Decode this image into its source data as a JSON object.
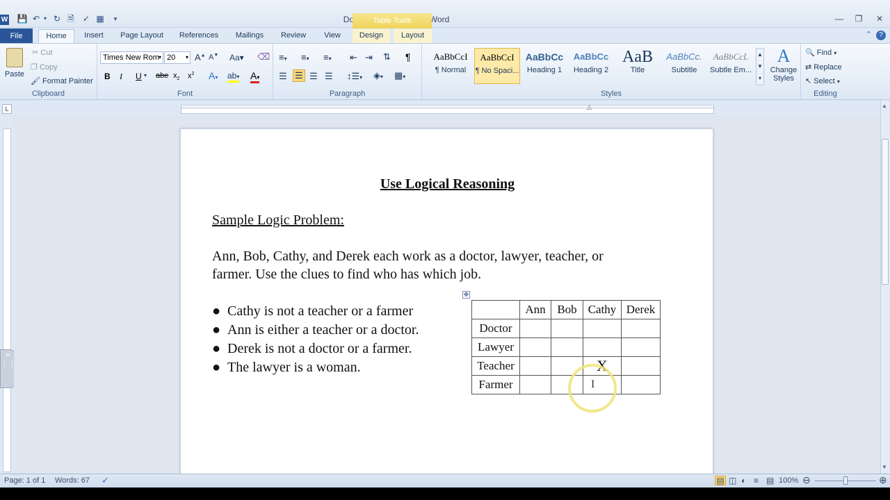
{
  "window": {
    "title": "Document1 - Microsoft Word",
    "context_tab": "Table Tools"
  },
  "tabs": {
    "file": "File",
    "home": "Home",
    "insert": "Insert",
    "page_layout": "Page Layout",
    "references": "References",
    "mailings": "Mailings",
    "review": "Review",
    "view": "View",
    "design": "Design",
    "layout": "Layout"
  },
  "clipboard": {
    "paste": "Paste",
    "cut": "Cut",
    "copy": "Copy",
    "format_painter": "Format Painter",
    "label": "Clipboard"
  },
  "font": {
    "name": "Times New Rom",
    "size": "20",
    "label": "Font"
  },
  "paragraph": {
    "label": "Paragraph"
  },
  "styles": {
    "label": "Styles",
    "items": [
      {
        "sample": "AaBbCcI",
        "name": "¶ Normal"
      },
      {
        "sample": "AaBbCcI",
        "name": "¶ No Spaci..."
      },
      {
        "sample": "AaBbCc",
        "name": "Heading 1"
      },
      {
        "sample": "AaBbCc",
        "name": "Heading 2"
      },
      {
        "sample": "AaB",
        "name": "Title"
      },
      {
        "sample": "AaBbCc.",
        "name": "Subtitle"
      },
      {
        "sample": "AaBbCcL",
        "name": "Subtle Em..."
      }
    ],
    "change_styles": "Change Styles"
  },
  "editing": {
    "find": "Find",
    "replace": "Replace",
    "select": "Select",
    "label": "Editing"
  },
  "document": {
    "title": "Use Logical Reasoning",
    "subtitle": "Sample Logic Problem:",
    "para_line1": "Ann, Bob, Cathy, and Derek each work as a doctor, lawyer, teacher, or",
    "para_line2": "farmer.  Use the clues to find who has which job.",
    "clues": [
      "Cathy is not a teacher or a farmer",
      "Ann is either a teacher or a doctor.",
      "Derek is not a doctor or a farmer.",
      "The lawyer is a woman."
    ],
    "table": {
      "headers": [
        "",
        "Ann",
        "Bob",
        "Cathy",
        "Derek"
      ],
      "rows": [
        [
          "Doctor",
          "",
          "",
          "",
          ""
        ],
        [
          "Lawyer",
          "",
          "",
          "",
          ""
        ],
        [
          "Teacher",
          "",
          "",
          "X",
          ""
        ],
        [
          "Farmer",
          "",
          "",
          "",
          ""
        ]
      ]
    }
  },
  "status": {
    "page": "Page: 1 of 1",
    "words": "Words: 67",
    "zoom": "100%"
  }
}
